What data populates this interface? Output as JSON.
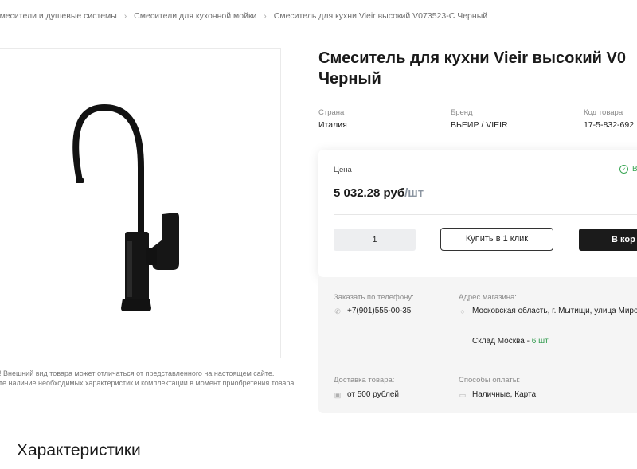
{
  "breadcrumbs": [
    "Смесители и душевые системы",
    "Смесители для кухонной мойки",
    "Смеситель для кухни Vieir высокий V073523-C Черный"
  ],
  "product": {
    "title_line1": "Смеситель для кухни Vieir высокий V0",
    "title_line2": "Черный",
    "props": [
      {
        "label": "Страна",
        "value": "Италия"
      },
      {
        "label": "Бренд",
        "value": "ВЬЕИР / VIEIR"
      },
      {
        "label": "Код товара",
        "value": "17-5-832-692"
      }
    ],
    "disclaimer_line1": "е! Внешний вид товара может отличаться от представленного на настоящем сайте.",
    "disclaimer_line2": "йте наличие необходимых характеристик и комплектации в момент приобретения товара."
  },
  "price_card": {
    "price_label": "Цена",
    "availability": "В",
    "price": "5 032.28 руб",
    "price_unit": "/шт",
    "quantity": "1",
    "one_click_label": "Купить в 1 клик",
    "cart_label": "В кор"
  },
  "info": {
    "phone_label": "Заказать по телефону:",
    "phone": "+7(901)555-00-35",
    "address_label": "Адрес магазина:",
    "address": "Московская область, г. Мытищи, улица Миро, д",
    "stock_name": "Склад Москва",
    "stock_sep": " - ",
    "stock_count": "6 шт",
    "delivery_label": "Доставка товара:",
    "delivery": "от 500 рублей",
    "payment_label": "Способы оплаты:",
    "payment": "Наличные, Карта"
  },
  "section_title": "Характеристики",
  "icons": {
    "availability": "check-circle-icon",
    "phone": "phone-icon",
    "address": "location-pin-icon",
    "delivery": "truck-icon",
    "payment": "card-icon"
  },
  "colors": {
    "accent_dark": "#1b1b1b",
    "in_stock_green": "#2f9a4c",
    "panel_bg": "#f5f5f5"
  }
}
